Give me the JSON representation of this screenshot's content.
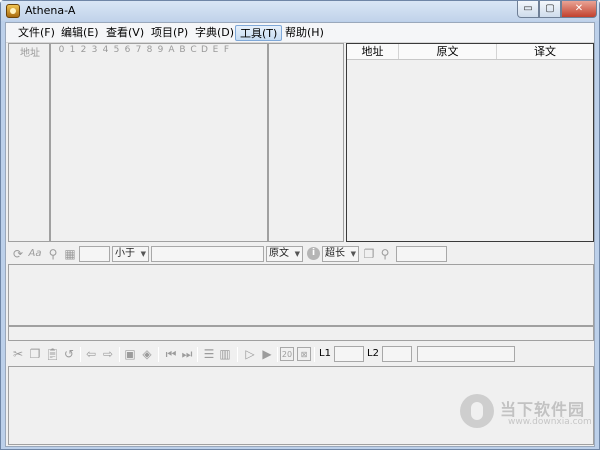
{
  "window": {
    "title": "Athena-A",
    "controls": {
      "minimize": "▭",
      "maximize": "▢",
      "close": "✕"
    }
  },
  "menu": {
    "items": [
      {
        "label": "文件(F)"
      },
      {
        "label": "编辑(E)"
      },
      {
        "label": "查看(V)"
      },
      {
        "label": "项目(P)"
      },
      {
        "label": "字典(D)"
      },
      {
        "label": "工具(T)",
        "active": true
      },
      {
        "label": "帮助(H)"
      }
    ]
  },
  "hex_view": {
    "address_header": "地址",
    "digits": [
      "0",
      "1",
      "2",
      "3",
      "4",
      "5",
      "6",
      "7",
      "8",
      "9",
      "A",
      "B",
      "C",
      "D",
      "E",
      "F"
    ]
  },
  "string_table": {
    "columns": [
      "地址",
      "原文",
      "译文"
    ]
  },
  "search_toolbar": {
    "compare_select": "小于",
    "field_select": "原文",
    "length_select": "超长",
    "icons": [
      "refresh-icon",
      "font-icon",
      "find-icon",
      "grid-icon",
      "info-icon",
      "copy-icon",
      "search-icon"
    ]
  },
  "edit_toolbar": {
    "l1_label": "L1",
    "l2_label": "L2",
    "icons": [
      "cut-icon",
      "copy-icon",
      "paste-icon",
      "undo-icon",
      "back-arrow-icon",
      "forward-arrow-icon",
      "save-icon",
      "save-all-icon",
      "first-icon",
      "last-icon",
      "list-icon",
      "columns-icon",
      "play-outline-icon",
      "play-icon",
      "zoom-20-icon",
      "zoom-fit-icon"
    ]
  },
  "watermark": {
    "name": "当下软件园",
    "url": "www.downxia.com"
  },
  "colors": {
    "titlebar": "#c9d9ee",
    "client_bg": "#f0f0f0",
    "menu_active": "#c7dcf2"
  }
}
